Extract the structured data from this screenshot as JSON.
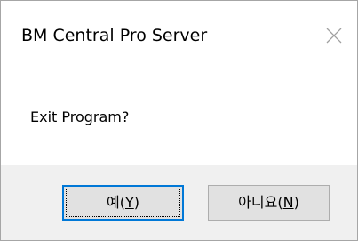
{
  "window": {
    "title": "BM Central Pro Server",
    "close_icon": "close-icon"
  },
  "dialog": {
    "message": "Exit Program?"
  },
  "buttons": {
    "yes": {
      "label": "예",
      "mnemonic_open": "(",
      "mnemonic": "Y",
      "mnemonic_close": ")"
    },
    "no": {
      "label": "아니요",
      "mnemonic_open": "(",
      "mnemonic": "N",
      "mnemonic_close": ")"
    }
  },
  "colors": {
    "button_bar": "#f0f0f0",
    "default_button_border": "#0078d7",
    "button_face": "#e1e1e1"
  }
}
